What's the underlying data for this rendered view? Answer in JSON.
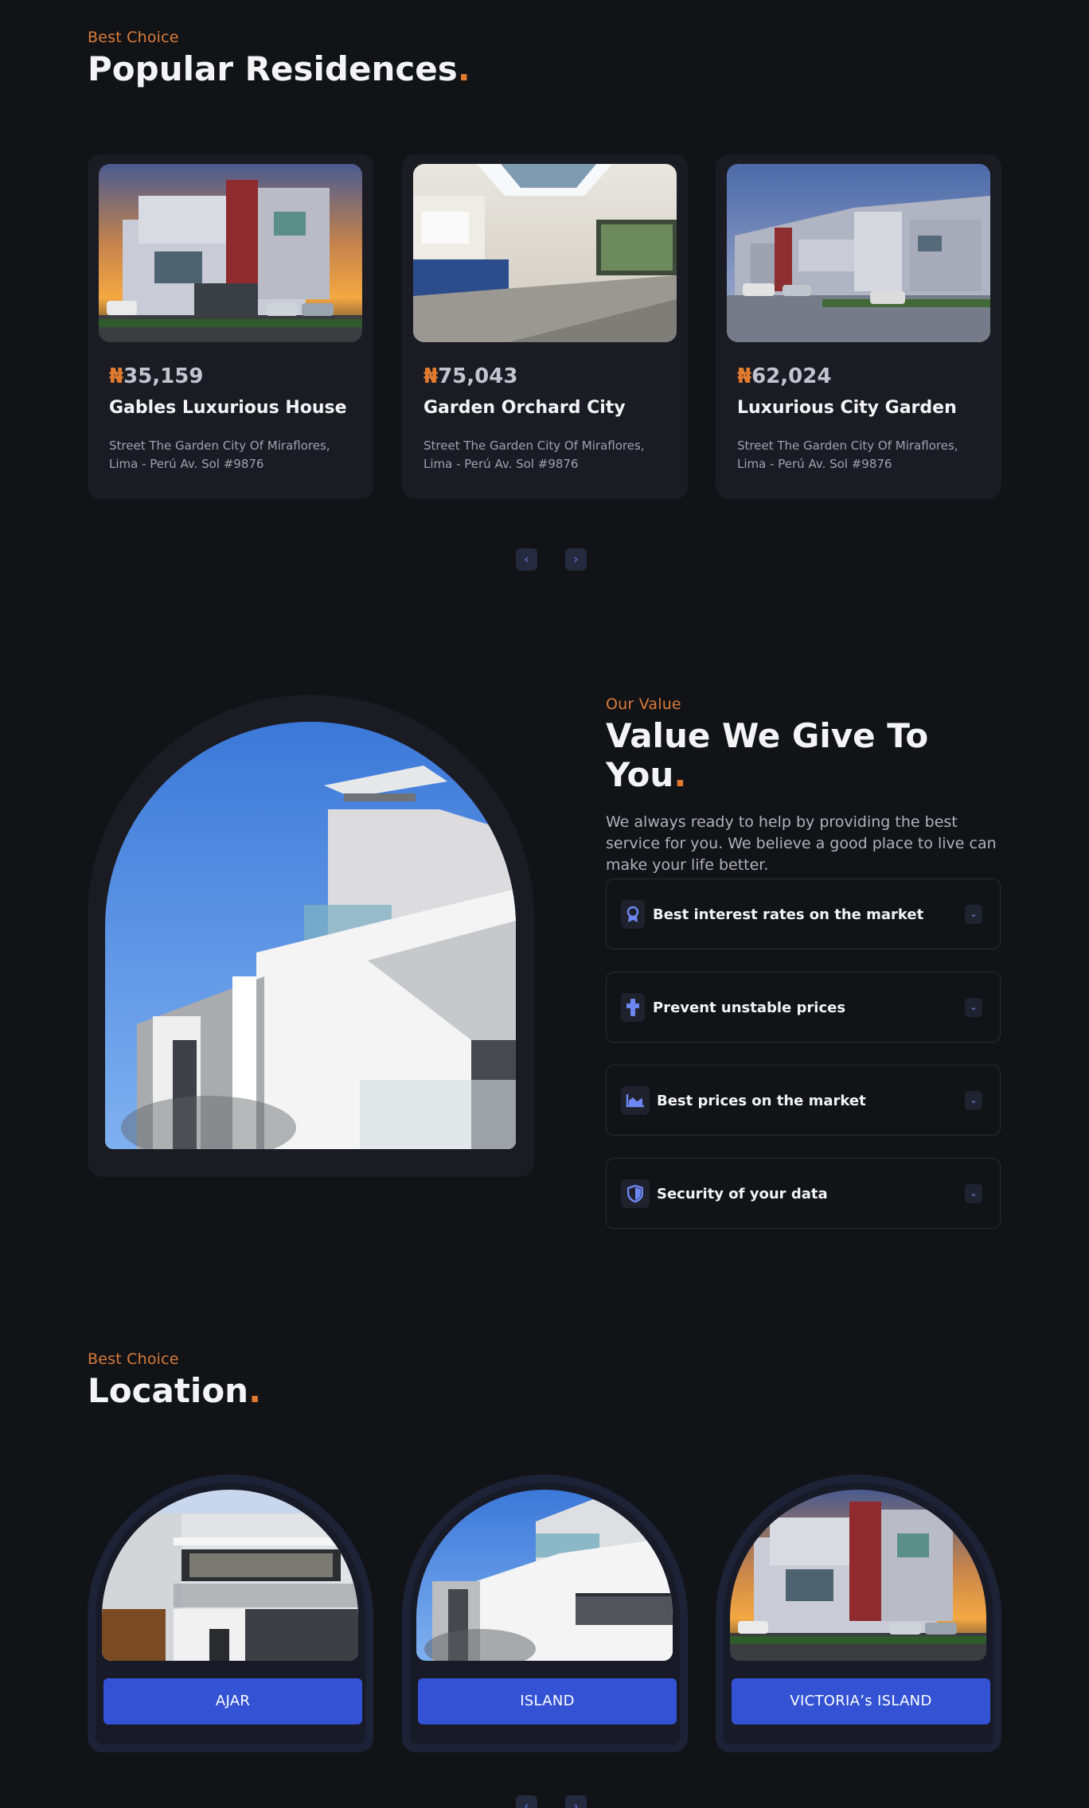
{
  "popular": {
    "eyebrow": "Best Choice",
    "title": "Popular Residences",
    "title_dot": ".",
    "cards": [
      {
        "currency": "₦",
        "price": "35,159",
        "name": "Gables Luxurious House",
        "address": "Street The Garden City Of Miraflores, Lima - Perú Av. Sol #9876",
        "image": "modern-house-sunset"
      },
      {
        "currency": "₦",
        "price": "75,043",
        "name": "Garden Orchard City",
        "address": "Street The Garden City Of Miraflores, Lima - Perú Av. Sol #9876",
        "image": "bright-interior-kitchen"
      },
      {
        "currency": "₦",
        "price": "62,024",
        "name": "Luxurious City Garden",
        "address": "Street The Garden City Of Miraflores, Lima - Perú Av. Sol #9876",
        "image": "townhouse-row"
      }
    ],
    "prev_icon": "‹",
    "next_icon": "›"
  },
  "value": {
    "eyebrow": "Our Value",
    "title": "Value We Give To You",
    "title_dot": ".",
    "description": "We always ready to help by providing the best service for you. We believe a good place to live can make your life better.",
    "items": [
      {
        "label": "Best interest rates on the market",
        "icon": "award-icon"
      },
      {
        "label": "Prevent unstable prices",
        "icon": "cross-icon"
      },
      {
        "label": "Best prices on the market",
        "icon": "chart-icon"
      },
      {
        "label": "Security of your data",
        "icon": "shield-icon"
      }
    ],
    "chevron": "⌄"
  },
  "location": {
    "eyebrow": "Best Choice",
    "title": "Location",
    "title_dot": ".",
    "items": [
      {
        "label": "AJAR",
        "image": "white-modern-house"
      },
      {
        "label": "ISLAND",
        "image": "white-building-sky"
      },
      {
        "label": "VICTORIA’s ISLAND",
        "image": "modern-house-sunset"
      }
    ]
  },
  "colors": {
    "background": "#121317",
    "card": "#1b1c23",
    "accent_orange": "#e07a2e",
    "accent_blue": "#3352d4"
  }
}
